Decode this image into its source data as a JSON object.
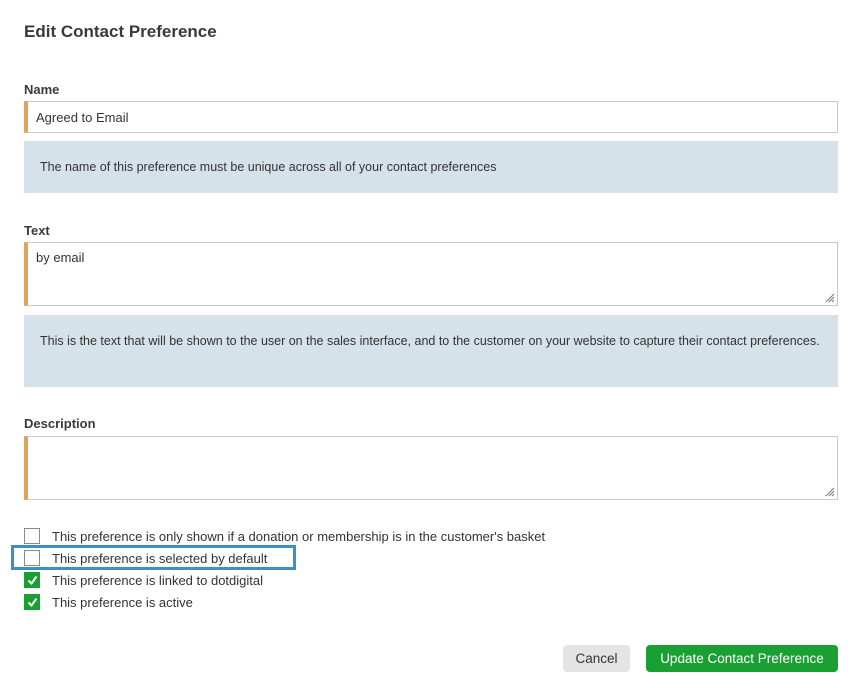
{
  "page_title": "Edit Contact Preference",
  "name_field": {
    "label": "Name",
    "value": "Agreed to Email",
    "help": "The name of this preference must be unique across all of your contact preferences"
  },
  "text_field": {
    "label": "Text",
    "value": "by email",
    "help": "This is the text that will be shown to the user on the sales interface, and to the customer on your website to capture their contact preferences."
  },
  "description_field": {
    "label": "Description",
    "value": ""
  },
  "checkboxes": [
    {
      "label": "This preference is only shown if a donation or membership is in the customer's basket",
      "checked": false
    },
    {
      "label": "This preference is selected by default",
      "checked": false
    },
    {
      "label": "This preference is linked to dotdigital",
      "checked": true
    },
    {
      "label": "This preference is active",
      "checked": true
    }
  ],
  "buttons": {
    "cancel": "Cancel",
    "update": "Update Contact Preference"
  },
  "colors": {
    "accent_border": "#e0a25a",
    "help_bg": "#d6e2e9",
    "primary": "#1aa032",
    "highlight": "#3d8fc4"
  }
}
